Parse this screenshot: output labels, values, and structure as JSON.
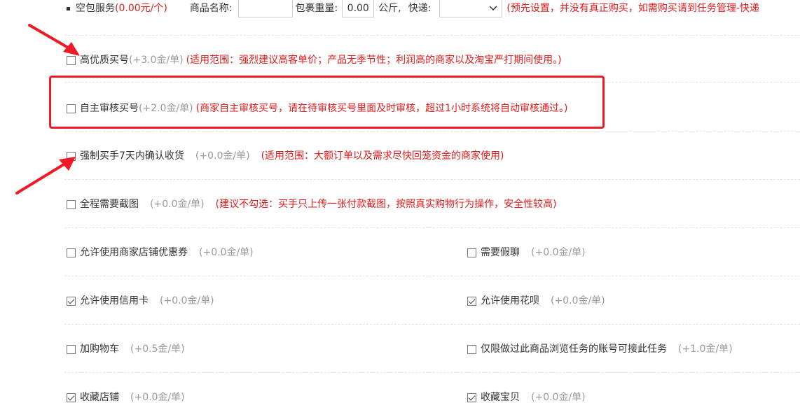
{
  "top": {
    "service_label": "空包服务",
    "service_price": "(0.00元/个)",
    "name_label": "商品名称:",
    "name_value": "",
    "weight_label": "包裹重量:",
    "weight_value": "0.00",
    "weight_unit": "公斤,",
    "express_label": "快递:",
    "express_value": "",
    "notice": "(预先设置，并没有真正购买，如需购买请到任务管理-快递"
  },
  "options": [
    {
      "label": "高优质买号",
      "price": "(+3.0金/单)",
      "note": "(适用范围：强烈建议高客单价；产品无季节性；利润高的商家以及淘宝严打期间使用。)",
      "checked": false
    },
    {
      "label": "自主审核买号",
      "price": "(+2.0金/单)",
      "note": "(商家自主审核买号，请在待审核买号里面及时审核，超过1小时系统将自动审核通过。)",
      "checked": false
    },
    {
      "label": "强制买手7天内确认收货",
      "price": "(+0.0金/单)",
      "note": "(适用范围：大额订单以及需求尽快回笼资金的商家使用)",
      "checked": false
    },
    {
      "label": "全程需要截图",
      "price": "(+0.0金/单)",
      "note": "(建议不勾选：买手只上传一张付款截图，按照真实购物行为操作，安全性较高)",
      "checked": false
    }
  ],
  "pairs": [
    {
      "left": {
        "label": "允许使用商家店铺优惠券",
        "price": "(+0.0金/单)",
        "checked": false
      },
      "right": {
        "label": "需要假聊",
        "price": "(+0.0金/单)",
        "checked": false
      }
    },
    {
      "left": {
        "label": "允许使用信用卡",
        "price": "(+0.0金/单)",
        "checked": true
      },
      "right": {
        "label": "允许使用花呗",
        "price": "(+0.0金/单)",
        "checked": true
      }
    },
    {
      "left": {
        "label": "加购物车",
        "price": "(+0.5金/单)",
        "checked": false
      },
      "right": {
        "label": "仅限做过此商品浏览任务的账号可接此任务",
        "price": "(+1.0金/单)",
        "checked": false
      }
    },
    {
      "left": {
        "label": "收藏店铺",
        "price": "(+0.0金/单)",
        "checked": true
      },
      "right": {
        "label": "收藏宝贝",
        "price": "(+0.0金/单)",
        "checked": true
      }
    }
  ]
}
